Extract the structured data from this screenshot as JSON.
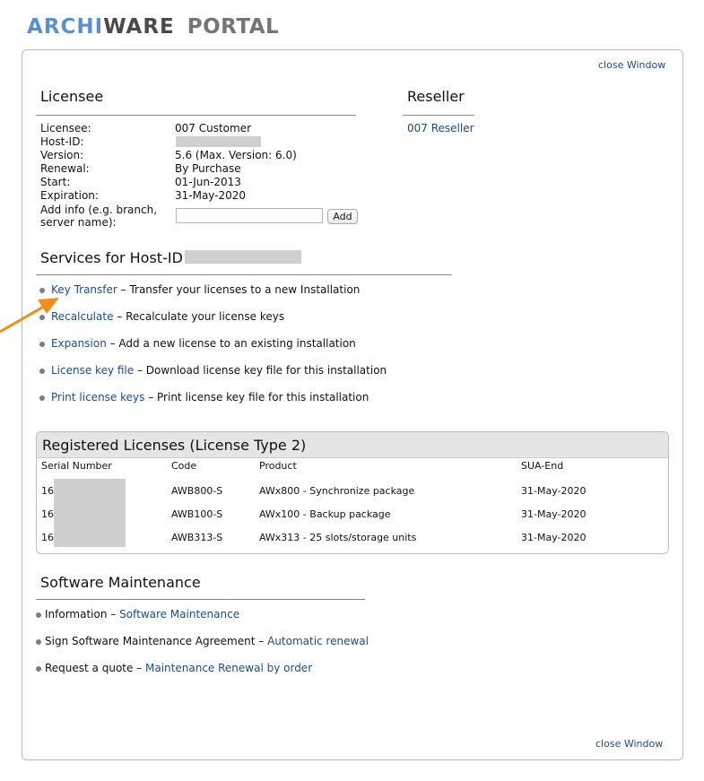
{
  "header": {
    "brand_part1": "ARCHI",
    "brand_part2": "WARE",
    "brand_suffix": "PORTAL"
  },
  "links": {
    "close_top": "close Window",
    "close_bottom": "close Window"
  },
  "licensee": {
    "title": "Licensee",
    "fields": [
      {
        "label": "Licensee:",
        "value": "007 Customer"
      },
      {
        "label": "Host-ID:",
        "value": ""
      },
      {
        "label": "Version:",
        "value": "5.6  (Max. Version: 6.0)"
      },
      {
        "label": "Renewal:",
        "value": "By Purchase"
      },
      {
        "label": "Start:",
        "value": "01-Jun-2013"
      },
      {
        "label": "Expiration:",
        "value": "31-May-2020"
      }
    ],
    "add_info_label_1": "Add info (e.g. branch,",
    "add_info_label_2": "server name):",
    "add_info_value": "",
    "add_button": "Add"
  },
  "reseller": {
    "title": "Reseller",
    "name": "007 Reseller"
  },
  "services": {
    "title": "Services for Host-ID",
    "items": [
      {
        "link": "Key Transfer",
        "desc": " – Transfer your licenses to a new Installation"
      },
      {
        "link": "Recalculate",
        "desc": " – Recalculate your license keys"
      },
      {
        "link": "Expansion",
        "desc": " – Add a new license to an existing installation"
      },
      {
        "link": "License key file",
        "desc": "  – Download license key file for this installation"
      },
      {
        "link": "Print license keys",
        "desc": "  – Print license key file for this installation"
      }
    ]
  },
  "registered": {
    "title": "Registered Licenses (License Type 2)",
    "columns": [
      "Serial Number",
      "Code",
      "Product",
      "SUA-End"
    ],
    "rows": [
      {
        "serial": "16",
        "code": "AWB800-S",
        "product": "AWx800 - Synchronize package",
        "sua_end": "31-May-2020"
      },
      {
        "serial": "16",
        "code": "AWB100-S",
        "product": "AWx100 - Backup package",
        "sua_end": "31-May-2020"
      },
      {
        "serial": "16",
        "code": "AWB313-S",
        "product": "AWx313 - 25 slots/storage units",
        "sua_end": "31-May-2020"
      }
    ]
  },
  "maintenance": {
    "title": "Software Maintenance",
    "items": [
      {
        "text": "Information – ",
        "link": "Software Maintenance"
      },
      {
        "text": "Sign Software Maintenance Agreement – ",
        "link": "Automatic renewal"
      },
      {
        "text": "Request a quote – ",
        "link": "Maintenance Renewal by order"
      }
    ]
  },
  "colors": {
    "link": "#1f4a86",
    "logo_blue": "#5b8fcf",
    "arrow": "#f28c1e"
  }
}
